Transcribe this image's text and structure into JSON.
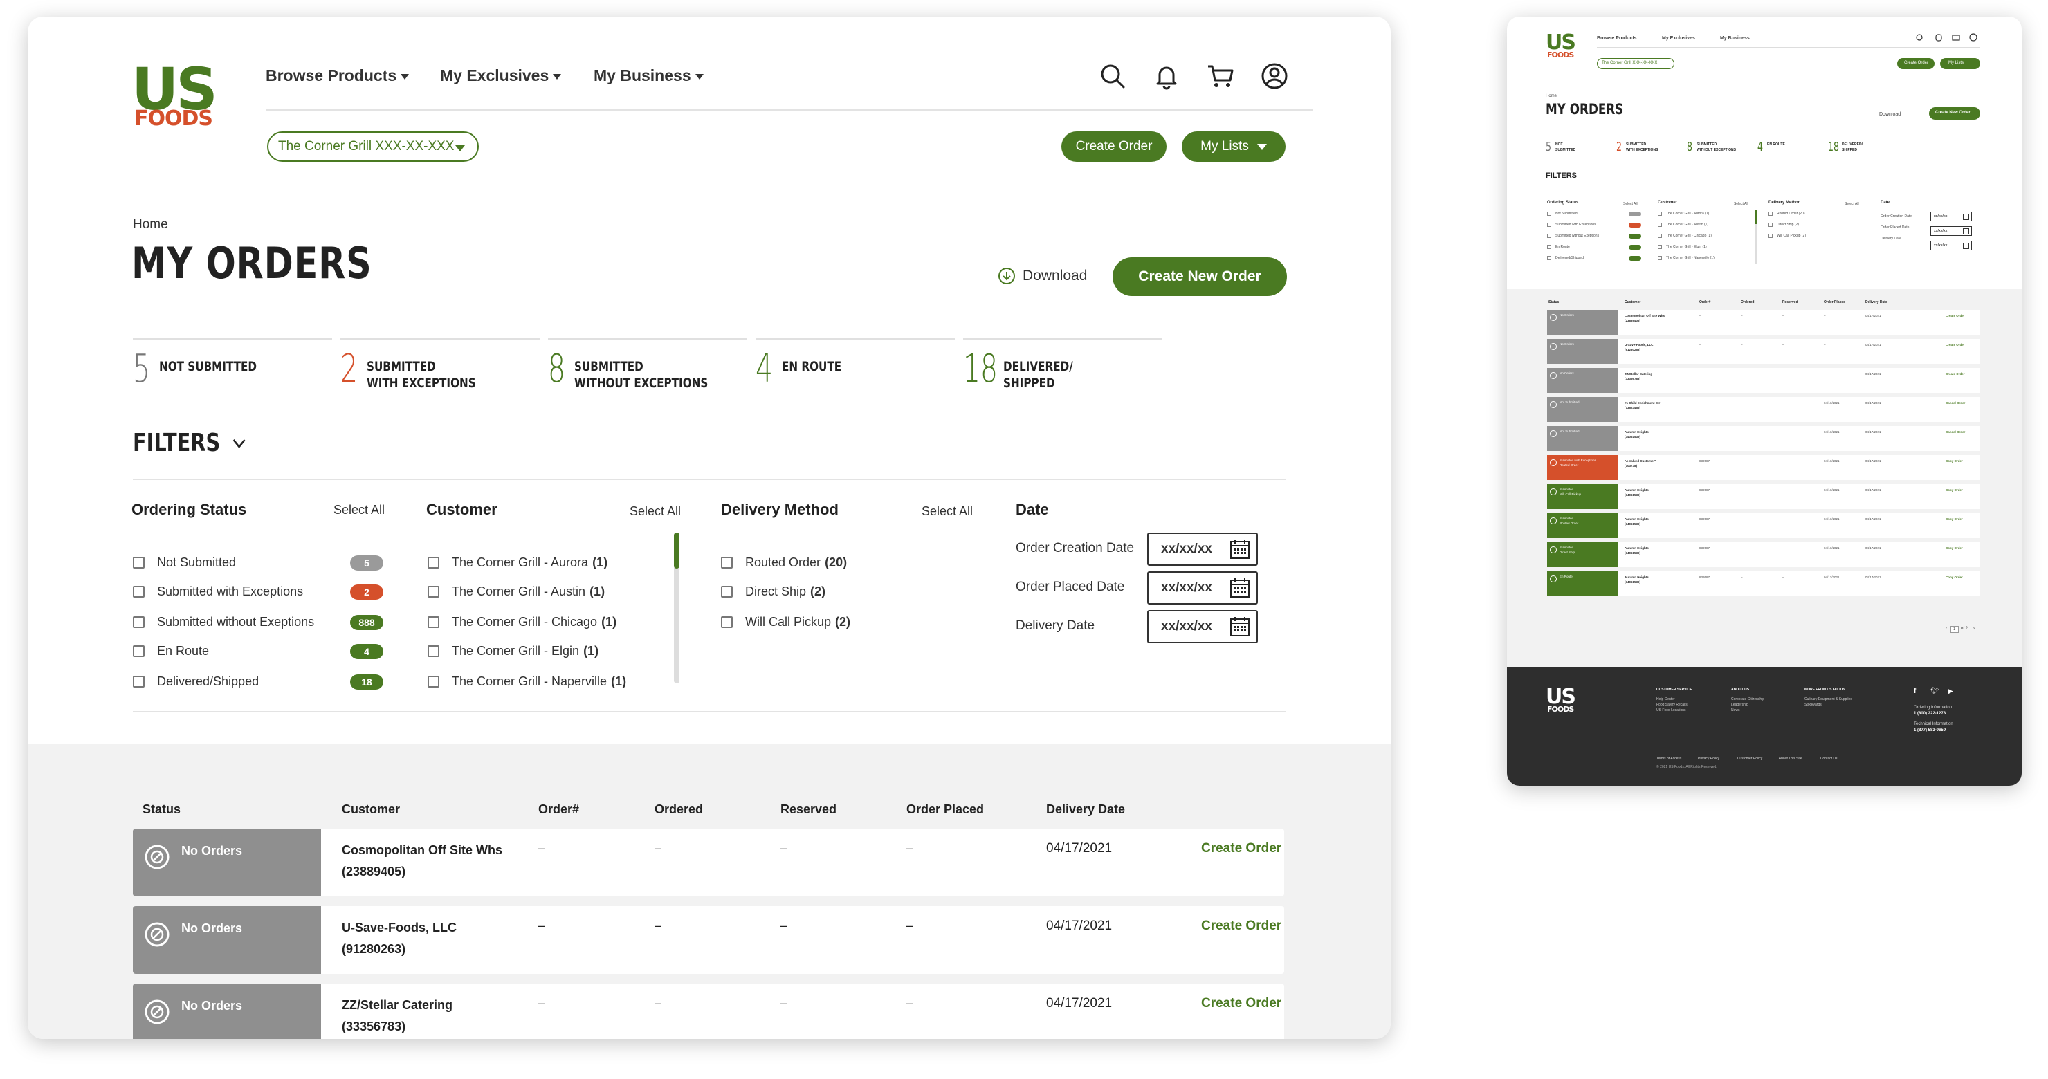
{
  "logo": {
    "us": "US",
    "foods": "FOODS"
  },
  "nav": {
    "items": [
      {
        "label": "Browse Products"
      },
      {
        "label": "My Exclusives"
      },
      {
        "label": "My Business"
      }
    ],
    "icons": [
      "search-icon",
      "bell-icon",
      "cart-icon",
      "account-icon"
    ]
  },
  "customer_select": "The Corner Grill XXX-XX-XXX",
  "header_buttons": {
    "create_order": "Create Order",
    "my_lists": "My Lists"
  },
  "breadcrumb": "Home",
  "page_title": "MY ORDERS",
  "download": "Download",
  "create_new_order": "Create New Order",
  "stats": [
    {
      "num": "5",
      "label": "NOT SUBMITTED",
      "color": "#777777"
    },
    {
      "num": "2",
      "label": "SUBMITTED\nWITH EXCEPTIONS",
      "color": "#d5502b"
    },
    {
      "num": "8",
      "label": "SUBMITTED\nWITHOUT EXCEPTIONS",
      "color": "#4a7a22"
    },
    {
      "num": "4",
      "label": "EN ROUTE",
      "color": "#4a7a22"
    },
    {
      "num": "18",
      "label": "DELIVERED/\nSHIPPED",
      "color": "#4a7a22"
    }
  ],
  "filters": {
    "title": "FILTERS",
    "ordering_status": {
      "title": "Ordering Status",
      "select_all": "Select All",
      "items": [
        {
          "label": "Not Submitted",
          "badge": "5",
          "color": "#9a9a9a"
        },
        {
          "label": "Submitted with Exceptions",
          "badge": "2",
          "color": "#d5502b"
        },
        {
          "label": "Submitted without Exeptions",
          "badge": "888",
          "color": "#4a7a22"
        },
        {
          "label": "En Route",
          "badge": "4",
          "color": "#4a7a22"
        },
        {
          "label": "Delivered/Shipped",
          "badge": "18",
          "color": "#4a7a22"
        }
      ]
    },
    "customer": {
      "title": "Customer",
      "select_all": "Select All",
      "items": [
        {
          "label": "The Corner Grill - Aurora",
          "count": "(1)"
        },
        {
          "label": "The Corner Grill - Austin",
          "count": "(1)"
        },
        {
          "label": "The Corner Grill - Chicago",
          "count": "(1)"
        },
        {
          "label": "The Corner Grill - Elgin",
          "count": "(1)"
        },
        {
          "label": "The Corner Grill - Naperville",
          "count": "(1)"
        }
      ]
    },
    "delivery_method": {
      "title": "Delivery Method",
      "select_all": "Select All",
      "items": [
        {
          "label": "Routed Order",
          "count": "(20)"
        },
        {
          "label": "Direct Ship",
          "count": "(2)"
        },
        {
          "label": "Will Call Pickup",
          "count": "(2)"
        }
      ]
    },
    "date": {
      "title": "Date",
      "fields": [
        {
          "label": "Order Creation Date",
          "value": "xx/xx/xx"
        },
        {
          "label": "Order Placed Date",
          "value": "xx/xx/xx"
        },
        {
          "label": "Delivery Date",
          "value": "xx/xx/xx"
        }
      ]
    }
  },
  "table": {
    "headers": [
      "Status",
      "Customer",
      "Order#",
      "Ordered",
      "Reserved",
      "Order Placed",
      "Delivery Date"
    ],
    "rows": [
      {
        "status": "No Orders",
        "customer": "Cosmopolitan Off Site Whs",
        "id": "(23889405)",
        "order": "–",
        "ordered": "–",
        "reserved": "–",
        "placed": "–",
        "delivery": "04/17/2021",
        "action": "Create Order"
      },
      {
        "status": "No Orders",
        "customer": "U-Save-Foods, LLC",
        "id": "(91280263)",
        "order": "–",
        "ordered": "–",
        "reserved": "–",
        "placed": "–",
        "delivery": "04/17/2021",
        "action": "Create Order"
      },
      {
        "status": "No Orders",
        "customer": "ZZ/Stellar Catering",
        "id": "(33356783)",
        "order": "–",
        "ordered": "–",
        "reserved": "–",
        "placed": "–",
        "delivery": "04/17/2021",
        "action": "Create Order"
      }
    ]
  },
  "preview": {
    "nav": [
      "Browse Products",
      "My Exclusives",
      "My Business"
    ],
    "customer_select": "The Corner Grill XXX-XX-XXX",
    "create_order": "Create Order",
    "my_lists": "My Lists",
    "breadcrumb": "Home",
    "title": "MY ORDERS",
    "download": "Download",
    "create_new_order": "Create New Order",
    "stats": [
      {
        "num": "5",
        "label": "NOT SUBMITTED",
        "color": "#777777"
      },
      {
        "num": "2",
        "label": "SUBMITTED WITH EXCEPTIONS",
        "color": "#d5502b"
      },
      {
        "num": "8",
        "label": "SUBMITTED WITHOUT EXCEPTIONS",
        "color": "#4a7a22"
      },
      {
        "num": "4",
        "label": "EN ROUTE",
        "color": "#4a7a22"
      },
      {
        "num": "18",
        "label": "DELIVERED/ SHIPPED",
        "color": "#4a7a22"
      }
    ],
    "filters": "FILTERS",
    "filter_cols": [
      {
        "title": "Ordering Status",
        "select_all": "Select All",
        "items": [
          "Not Submitted",
          "Submitted with Exceptions",
          "Submitted without Exeptions",
          "En Route",
          "Delivered/Shipped"
        ]
      },
      {
        "title": "Customer",
        "select_all": "Select All",
        "items": [
          "The Corner Grill - Aurora (1)",
          "The Corner Grill - Austin (1)",
          "The Corner Grill - Chicago (1)",
          "The Corner Grill - Elgin (1)",
          "The Corner Grill - Naperville (1)"
        ]
      },
      {
        "title": "Delivery Method",
        "select_all": "Select All",
        "items": [
          "Routed Order (20)",
          "Direct Ship (2)",
          "Will Call Pickup (2)"
        ]
      },
      {
        "title": "Date",
        "select_all": "",
        "items": [
          "Order Creation Date",
          "Order Placed Date",
          "Delivery Date"
        ]
      }
    ],
    "date_value": "xx/xx/xx",
    "headers": [
      "Status",
      "Customer",
      "Order#",
      "Ordered",
      "Reserved",
      "Order Placed",
      "Delivery Date"
    ],
    "rows": [
      {
        "status": "No Orders",
        "sub": "",
        "color": "#8f8f8f",
        "customer": "Cosmopolitan Off Site Whs",
        "id": "(23889405)",
        "order": "–",
        "ordered": "–",
        "reserved": "–",
        "placed": "–",
        "delivery": "04/17/2021",
        "action": "Create Order"
      },
      {
        "status": "No Orders",
        "sub": "",
        "color": "#8f8f8f",
        "customer": "U-Save-Foods, LLC",
        "id": "(91280263)",
        "order": "–",
        "ordered": "–",
        "reserved": "–",
        "placed": "–",
        "delivery": "04/17/2021",
        "action": "Create Order"
      },
      {
        "status": "No Orders",
        "sub": "",
        "color": "#8f8f8f",
        "customer": "ZZ/Stellar Catering",
        "id": "(33356783)",
        "order": "–",
        "ordered": "–",
        "reserved": "–",
        "placed": "–",
        "delivery": "04/17/2021",
        "action": "Create Order"
      },
      {
        "status": "Not Submitted",
        "sub": "",
        "color": "#8f8f8f",
        "customer": "#1 Child Enrichment Ctr",
        "id": "(73623455)",
        "order": "–",
        "ordered": "–",
        "reserved": "–",
        "placed": "04/17/2021",
        "delivery": "04/17/2021",
        "action": "Cancel Order"
      },
      {
        "status": "Not Submitted",
        "sub": "",
        "color": "#8f8f8f",
        "customer": "Autumn Heights",
        "id": "(34061539)",
        "order": "–",
        "ordered": "–",
        "reserved": "–",
        "placed": "04/17/2021",
        "delivery": "04/17/2021",
        "action": "Cancel Order"
      },
      {
        "status": "Submitted with Exceptions",
        "sub": "Routed Order",
        "color": "#d5502b",
        "customer": "\"A Valued Customer\"",
        "id": "(703738)",
        "order": "839587",
        "ordered": "–",
        "reserved": "–",
        "placed": "04/17/2021",
        "delivery": "04/17/2021",
        "action": "Copy Order"
      },
      {
        "status": "Submitted",
        "sub": "Will Call Pickup",
        "color": "#4a7a22",
        "customer": "Autumn Heights",
        "id": "(34061539)",
        "order": "839587",
        "ordered": "–",
        "reserved": "–",
        "placed": "04/17/2021",
        "delivery": "04/17/2021",
        "action": "Copy Order"
      },
      {
        "status": "Submitted",
        "sub": "Routed Order",
        "color": "#4a7a22",
        "customer": "Autumn Heights",
        "id": "(34061539)",
        "order": "839587",
        "ordered": "–",
        "reserved": "–",
        "placed": "04/17/2021",
        "delivery": "04/17/2021",
        "action": "Copy Order"
      },
      {
        "status": "Submitted",
        "sub": "Direct Ship",
        "color": "#4a7a22",
        "customer": "Autumn Heights",
        "id": "(34061539)",
        "order": "839587",
        "ordered": "–",
        "reserved": "–",
        "placed": "04/17/2021",
        "delivery": "04/17/2021",
        "action": "Copy Order"
      },
      {
        "status": "En Route",
        "sub": "",
        "color": "#4a7a22",
        "customer": "Autumn Heights",
        "id": "(34061539)",
        "order": "839587",
        "ordered": "–",
        "reserved": "–",
        "placed": "04/17/2021",
        "delivery": "04/17/2021",
        "action": "Copy Order"
      }
    ],
    "pagination": {
      "current": "1",
      "of": "of 2"
    },
    "footer": {
      "cols": [
        {
          "title": "CUSTOMER SERVICE",
          "links": [
            "Help Center",
            "Food Safety Recalls",
            "US Food Locations"
          ]
        },
        {
          "title": "ABOUT US",
          "links": [
            "Corporate Citizenship",
            "Leadership",
            "News"
          ]
        },
        {
          "title": "MORE FROM US FOODS",
          "links": [
            "Culinary Equipment & Supplies",
            "Stockyards"
          ]
        }
      ],
      "ordering_info": "Ordering Information",
      "ordering_phone": "1 (800) 222-1278",
      "tech_info": "Technical Information",
      "tech_phone": "1 (877) 583-9659",
      "legal": [
        "Terms of Access",
        "Privacy Policy",
        "Customer Policy",
        "About This Site",
        "Contact Us"
      ],
      "copyright": "© 2021 US Foods. All Rights Reserved."
    }
  }
}
